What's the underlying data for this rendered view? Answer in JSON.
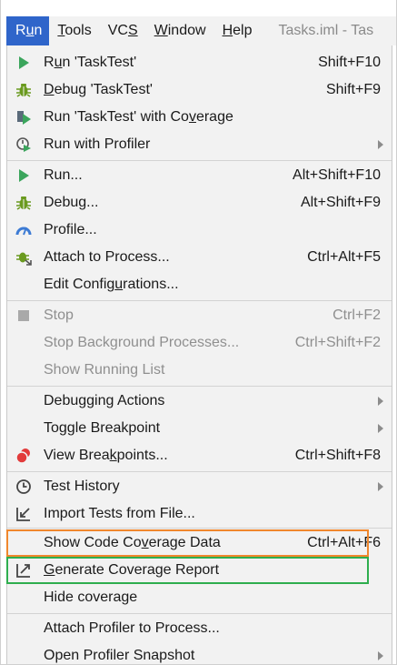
{
  "menubar": {
    "items": [
      {
        "pre": "R",
        "mn": "u",
        "post": "n"
      },
      {
        "pre": "",
        "mn": "T",
        "post": "ools"
      },
      {
        "pre": "VC",
        "mn": "S",
        "post": ""
      },
      {
        "pre": "",
        "mn": "W",
        "post": "indow"
      },
      {
        "pre": "",
        "mn": "H",
        "post": "elp"
      }
    ],
    "file_title": "Tasks.iml - Tas"
  },
  "menu": {
    "items": [
      {
        "pre": "R",
        "mn": "u",
        "post": "n 'TaskTest'",
        "shortcut": "Shift+F10"
      },
      {
        "pre": "",
        "mn": "D",
        "post": "ebug 'TaskTest'",
        "shortcut": "Shift+F9"
      },
      {
        "pre": "Run 'TaskTest' with Co",
        "mn": "v",
        "post": "erage",
        "shortcut": ""
      },
      {
        "pre": "Run with Profiler",
        "mn": "",
        "post": "",
        "shortcut": ""
      },
      {
        "pre": "Run...",
        "mn": "",
        "post": "",
        "shortcut": "Alt+Shift+F10"
      },
      {
        "pre": "Debug...",
        "mn": "",
        "post": "",
        "shortcut": "Alt+Shift+F9"
      },
      {
        "pre": "Profile...",
        "mn": "",
        "post": "",
        "shortcut": ""
      },
      {
        "pre": "Attach to Process...",
        "mn": "",
        "post": "",
        "shortcut": "Ctrl+Alt+F5"
      },
      {
        "pre": "Edit Config",
        "mn": "u",
        "post": "rations...",
        "shortcut": ""
      },
      {
        "pre": "Stop",
        "mn": "",
        "post": "",
        "shortcut": "Ctrl+F2"
      },
      {
        "pre": "Stop Background Processes...",
        "mn": "",
        "post": "",
        "shortcut": "Ctrl+Shift+F2"
      },
      {
        "pre": "Show Running List",
        "mn": "",
        "post": "",
        "shortcut": ""
      },
      {
        "pre": "Debugging Actions",
        "mn": "",
        "post": "",
        "shortcut": ""
      },
      {
        "pre": "Toggle Breakpoint",
        "mn": "",
        "post": "",
        "shortcut": ""
      },
      {
        "pre": "View Brea",
        "mn": "k",
        "post": "points...",
        "shortcut": "Ctrl+Shift+F8"
      },
      {
        "pre": "Test History",
        "mn": "",
        "post": "",
        "shortcut": ""
      },
      {
        "pre": "Import Tests from File...",
        "mn": "",
        "post": "",
        "shortcut": ""
      },
      {
        "pre": "Show Code Co",
        "mn": "v",
        "post": "erage Data",
        "shortcut": "Ctrl+Alt+F6"
      },
      {
        "pre": "",
        "mn": "G",
        "post": "enerate Coverage Report",
        "shortcut": ""
      },
      {
        "pre": "Hide coverage",
        "mn": "",
        "post": "",
        "shortcut": ""
      },
      {
        "pre": "Attach Profiler to Process...",
        "mn": "",
        "post": "",
        "shortcut": ""
      },
      {
        "pre": "Open Profiler Snapshot",
        "mn": "",
        "post": "",
        "shortcut": ""
      }
    ]
  },
  "colors": {
    "menu_bg": "#f2f2f2",
    "active_bg": "#2f65ca",
    "run_green": "#3ba55c",
    "debug_green": "#6a9a1f",
    "profile_blue": "#3d7bd4",
    "breakpoint_red": "#e23b3b",
    "highlight_orange": "#f0872c",
    "highlight_green": "#2eae4e",
    "disabled_text": "#8f8f8f"
  }
}
